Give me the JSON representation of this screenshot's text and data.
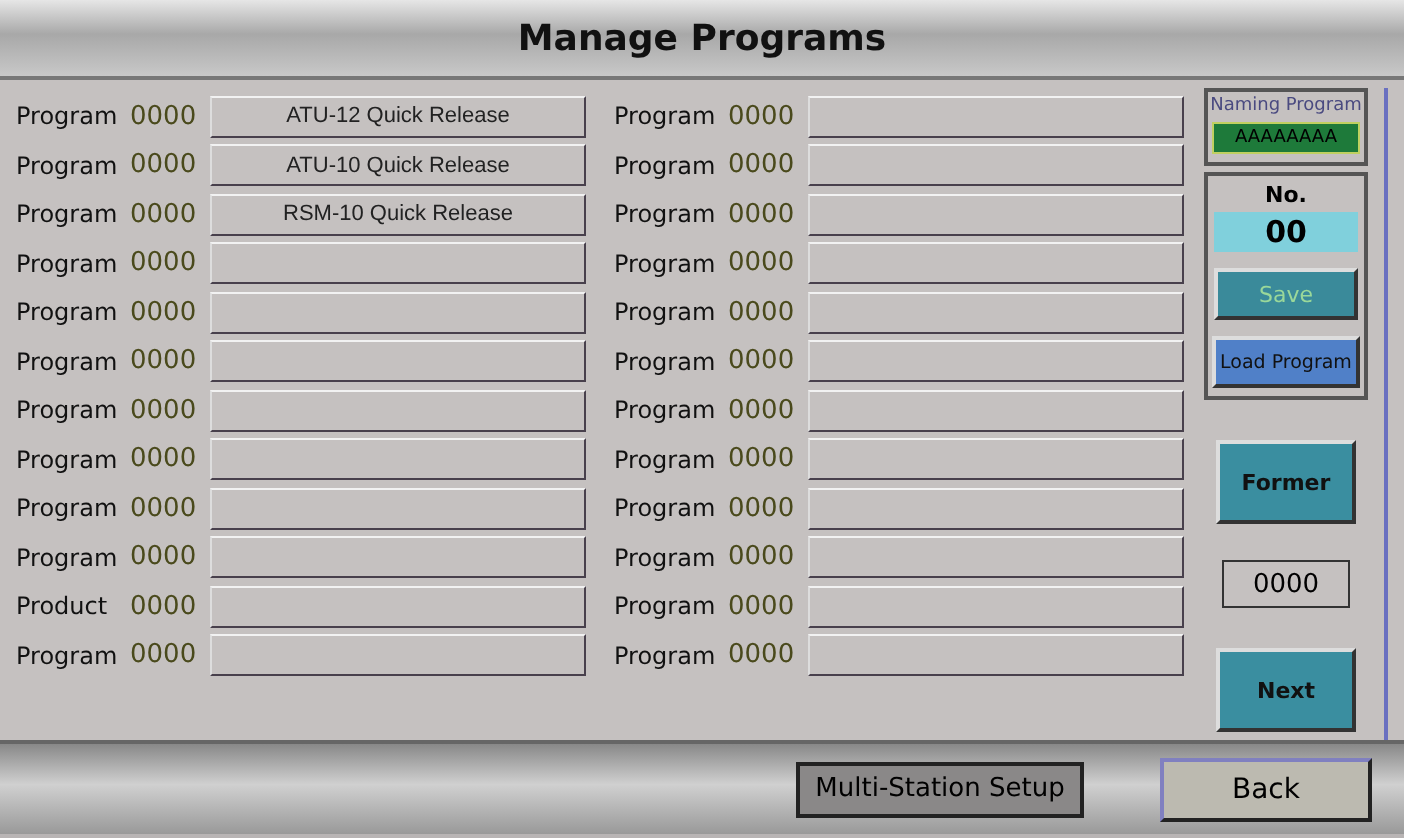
{
  "title": "Manage Programs",
  "left_rows": [
    {
      "label": "Program",
      "number": "0000",
      "name": "ATU-12 Quick Release"
    },
    {
      "label": "Program",
      "number": "0000",
      "name": "ATU-10 Quick Release"
    },
    {
      "label": "Program",
      "number": "0000",
      "name": "RSM-10 Quick Release"
    },
    {
      "label": "Program",
      "number": "0000"
    },
    {
      "label": "Program",
      "number": "0000"
    },
    {
      "label": "Program",
      "number": "0000"
    },
    {
      "label": "Program",
      "number": "0000"
    },
    {
      "label": "Program",
      "number": "0000"
    },
    {
      "label": "Program",
      "number": "0000"
    },
    {
      "label": "Program",
      "number": "0000"
    },
    {
      "label": "Product",
      "number": "0000"
    },
    {
      "label": "Program",
      "number": "0000"
    }
  ],
  "right_rows": [
    {
      "label": "Program",
      "number": "0000"
    },
    {
      "label": "Program",
      "number": "0000"
    },
    {
      "label": "Program",
      "number": "0000"
    },
    {
      "label": "Program",
      "number": "0000"
    },
    {
      "label": "Program",
      "number": "0000"
    },
    {
      "label": "Program",
      "number": "0000"
    },
    {
      "label": "Program",
      "number": "0000"
    },
    {
      "label": "Program",
      "number": "0000"
    },
    {
      "label": "Program",
      "number": "0000"
    },
    {
      "label": "Program",
      "number": "0000"
    },
    {
      "label": "Program",
      "number": "0000"
    },
    {
      "label": "Program",
      "number": "0000"
    }
  ],
  "side": {
    "naming_label": "Naming Program",
    "naming_value": "AAAAAAAA",
    "no_label": "No.",
    "no_value": "00",
    "save": {
      "label": "Save",
      "disabled": true
    },
    "load": {
      "label": "Load Program"
    },
    "former": "Former",
    "page": "0000",
    "next": "Next"
  },
  "bottom": {
    "multi_station": "Multi-Station Setup",
    "back": "Back"
  }
}
